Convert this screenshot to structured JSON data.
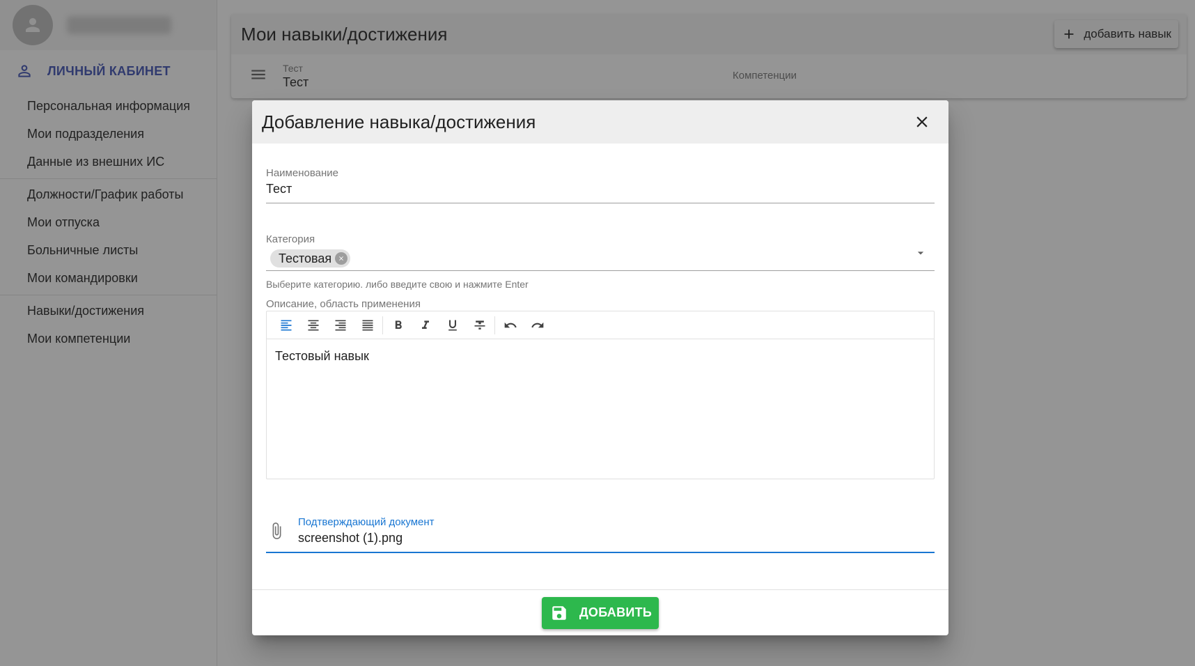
{
  "sidebar": {
    "cabinet_title": "ЛИЧНЫЙ КАБИНЕТ",
    "groups": [
      [
        "Персональная информация",
        "Мои подразделения",
        "Данные из внешних ИС"
      ],
      [
        "Должности/График работы",
        "Мои отпуска",
        "Больничные листы",
        "Мои командировки"
      ],
      [
        "Навыки/достижения",
        "Мои компетенции"
      ]
    ]
  },
  "main": {
    "title": "Мои навыки/достижения",
    "add_button_label": "добавить навык",
    "skill": {
      "caption": "Тест",
      "name": "Тест",
      "competencies_label": "Компетенции"
    }
  },
  "dialog": {
    "title": "Добавление навыка/достижения",
    "name_field": {
      "label": "Наименование",
      "value": "Тест"
    },
    "category_field": {
      "label": "Категория",
      "chip": "Тестовая",
      "hint": "Выберите категорию. либо введите свою и нажмите Enter"
    },
    "description": {
      "label": "Описание, область применения",
      "content": "Тестовый навык"
    },
    "file_field": {
      "label": "Подтверждающий документ",
      "value": "screenshot (1).png"
    },
    "submit_label": "ДОБАВИТЬ"
  },
  "colors": {
    "accent": "#3f51b5",
    "focus": "#1976d2",
    "submit": "#2db84d"
  }
}
